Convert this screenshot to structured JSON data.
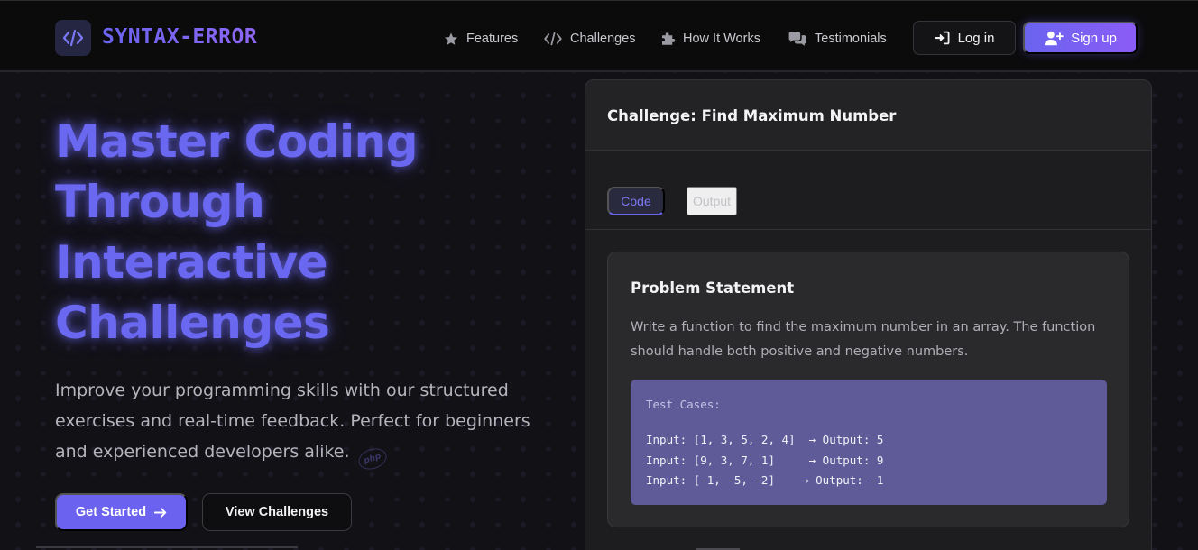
{
  "brand": {
    "name": "SYNTAX-ERROR",
    "logo_icon": "code-icon",
    "accent": "#6b63ef"
  },
  "nav": {
    "links": [
      {
        "label": "Features",
        "icon": "star-icon"
      },
      {
        "label": "Challenges",
        "icon": "code-icon"
      },
      {
        "label": "How It Works",
        "icon": "puzzle-icon"
      },
      {
        "label": "Testimonials",
        "icon": "comments-icon"
      }
    ],
    "login_label": "Log in",
    "signup_label": "Sign up"
  },
  "hero": {
    "title_lines": [
      "Master Coding",
      "Through",
      "Interactive",
      "Challenges"
    ],
    "subtitle": "Improve your programming skills with our structured exercises and real-time feedback. Perfect for beginners and experienced developers alike.",
    "primary_label": "Get Started",
    "secondary_label": "View Challenges",
    "badge_text": "php"
  },
  "challenge": {
    "title": "Challenge: Find Maximum Number",
    "tabs": [
      {
        "label": "Code",
        "active": true
      },
      {
        "label": "Output",
        "active": false
      }
    ],
    "problem_title": "Problem Statement",
    "problem_text": "Write a function to find the maximum number in an array. The function should handle both positive and negative numbers.",
    "test_cases_label": "Test Cases:",
    "test_cases": [
      "Input: [1, 3, 5, 2, 4]  → Output: 5",
      "Input: [9, 3, 7, 1]     → Output: 9",
      "Input: [-1, -5, -2]    → Output: -1"
    ]
  }
}
